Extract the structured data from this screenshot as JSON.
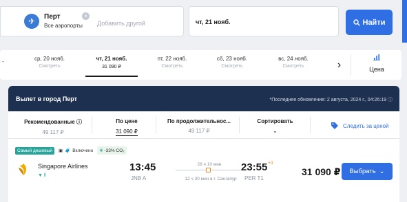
{
  "search": {
    "destination_city": "Перт",
    "destination_sub": "Все аэропорты",
    "add_destination": "Добавить другой",
    "date": "чт, 21 нояб.",
    "find_label": "Найти"
  },
  "date_strip": {
    "items": [
      {
        "date": "ср, 20 нояб.",
        "price": "Смотреть"
      },
      {
        "date": "чт, 21 нояб.",
        "price": "31 090 ₽"
      },
      {
        "date": "пт, 22 нояб.",
        "price": "Смотреть"
      },
      {
        "date": "сб, 23 нояб.",
        "price": "Смотреть"
      },
      {
        "date": "вс, 24 нояб.",
        "price": "Смотреть"
      }
    ],
    "price_toggle_label": "Цена"
  },
  "results": {
    "title": "Вылет в город Перт",
    "last_update": "*Последнее обновление: 2 августа, 2024 г., 04:26:19",
    "sort": {
      "recommended": {
        "label": "Рекомендованные",
        "value": "49 117 ₽"
      },
      "price": {
        "label": "По цене",
        "value": "31 090 ₽"
      },
      "duration": {
        "label": "По продолжительнос...",
        "value": "49 117 ₽"
      },
      "sort_label": "Сортировать"
    },
    "track_price_label": "Следить за ценой",
    "flight": {
      "badges": {
        "cheapest": "Самый дешевый",
        "included": "Включено",
        "co2": "-33% CO₂"
      },
      "airline": "Singapore Airlines",
      "dep_time": "13:45",
      "dep_airport": "JNB A",
      "duration": "28 ч 10 мин",
      "stop": "12 ч 30 мин в г. Сингапур",
      "arr_time": "23:55",
      "arr_plus": "+1",
      "arr_airport": "PER T1",
      "price": "31 090 ₽",
      "select_label": "Выбрать"
    }
  }
}
